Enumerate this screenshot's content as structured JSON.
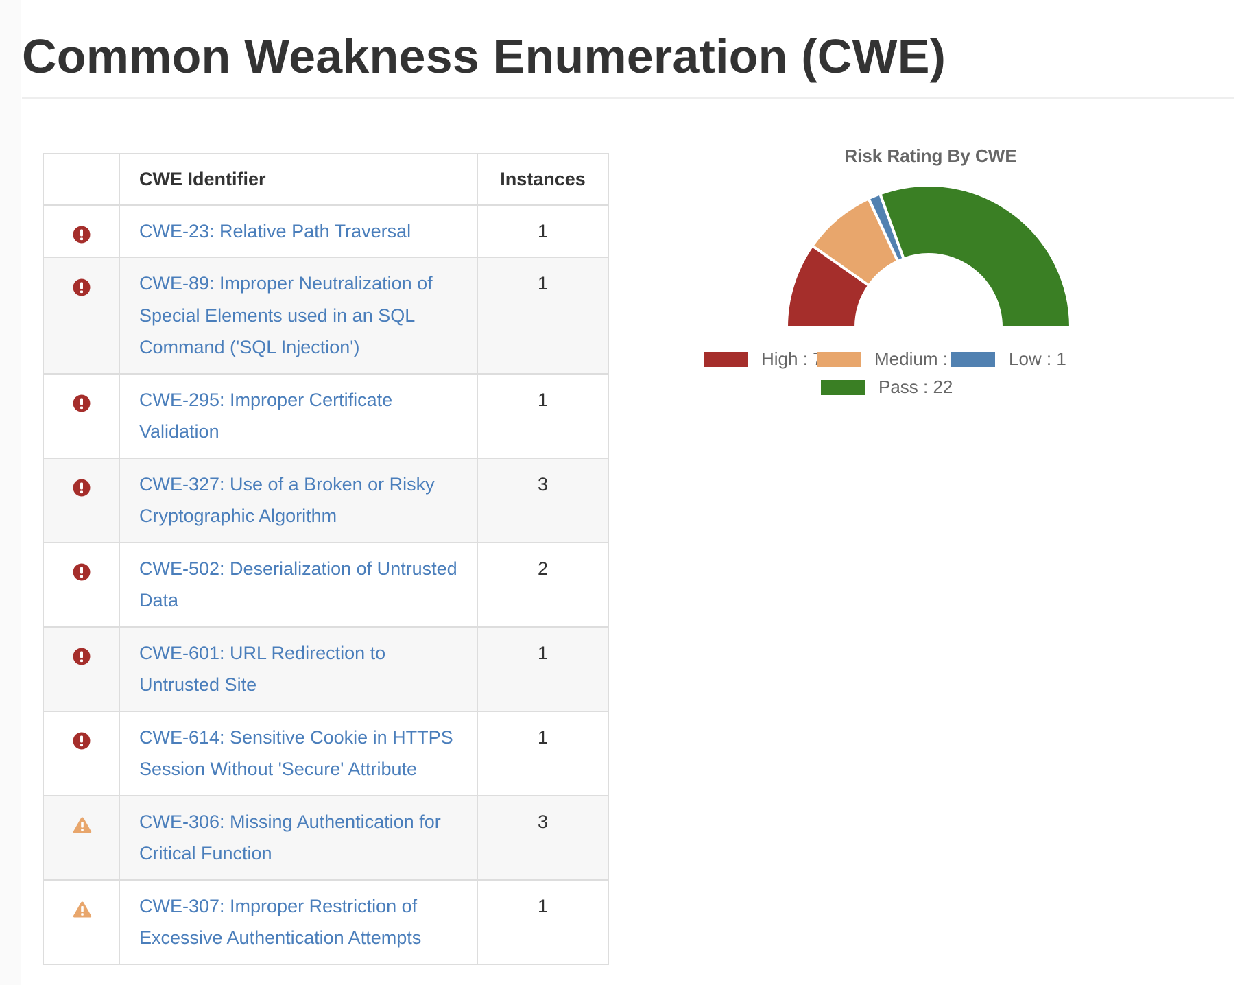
{
  "page": {
    "title": "Common Weakness Enumeration (CWE)"
  },
  "table": {
    "headers": {
      "icon": "",
      "identifier": "CWE Identifier",
      "instances": "Instances"
    },
    "rows": [
      {
        "severity": "high",
        "icon": "exclamation-circle-icon",
        "identifier": "CWE-23: Relative Path Traversal",
        "instances": "1"
      },
      {
        "severity": "high",
        "icon": "exclamation-circle-icon",
        "identifier": "CWE-89: Improper Neutralization of Special Elements used in an SQL Command ('SQL Injection')",
        "instances": "1"
      },
      {
        "severity": "high",
        "icon": "exclamation-circle-icon",
        "identifier": "CWE-295: Improper Certificate Validation",
        "instances": "1"
      },
      {
        "severity": "high",
        "icon": "exclamation-circle-icon",
        "identifier": "CWE-327: Use of a Broken or Risky Cryptographic Algorithm",
        "instances": "3"
      },
      {
        "severity": "high",
        "icon": "exclamation-circle-icon",
        "identifier": "CWE-502: Deserialization of Untrusted Data",
        "instances": "2"
      },
      {
        "severity": "high",
        "icon": "exclamation-circle-icon",
        "identifier": "CWE-601: URL Redirection to Untrusted Site",
        "instances": "1"
      },
      {
        "severity": "high",
        "icon": "exclamation-circle-icon",
        "identifier": "CWE-614: Sensitive Cookie in HTTPS Session Without 'Secure' Attribute",
        "instances": "1"
      },
      {
        "severity": "medium",
        "icon": "warning-triangle-icon",
        "identifier": "CWE-306: Missing Authentication for Critical Function",
        "instances": "3"
      },
      {
        "severity": "medium",
        "icon": "warning-triangle-icon",
        "identifier": "CWE-307: Improper Restriction of Excessive Authentication Attempts",
        "instances": "1"
      }
    ]
  },
  "colors": {
    "high": "#a52e2b",
    "medium": "#e8a66c",
    "low": "#5181b1",
    "pass": "#3a7f24",
    "link": "#4a7ebb"
  },
  "chart_data": {
    "type": "pie",
    "variant": "half-doughnut",
    "title": "Risk Rating By CWE",
    "categories": [
      "High",
      "Medium",
      "Low",
      "Pass"
    ],
    "values": [
      7,
      6,
      1,
      22
    ],
    "legend_labels": [
      "High : 7",
      "Medium : 6",
      "Low : 1",
      "Pass : 22"
    ],
    "colors": [
      "#a52e2b",
      "#e8a66c",
      "#5181b1",
      "#3a7f24"
    ],
    "legend_position": "bottom"
  }
}
